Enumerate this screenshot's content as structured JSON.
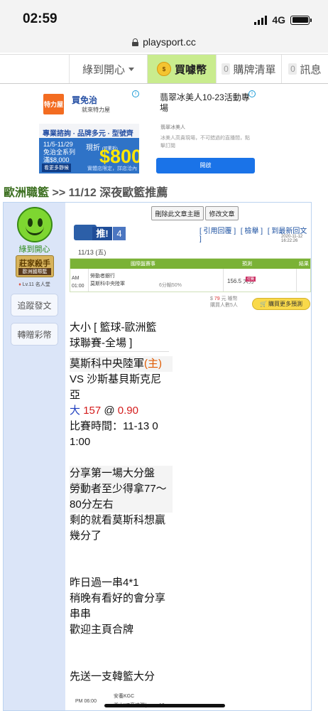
{
  "status": {
    "time": "02:59",
    "network": "4G"
  },
  "browser": {
    "url": "playsport.cc"
  },
  "nav": {
    "login": "綠到開心",
    "buy": "買噱幣",
    "cart_count": "0",
    "cart": "購牌清單",
    "msg_count": "0",
    "msg": "訊息"
  },
  "ads": {
    "left": {
      "brand": "特力屋",
      "headline": "買免治",
      "headline2": "就來特力屋",
      "sub": "專業諮詢 · 品牌多元 · 型號齊全",
      "date": "11/5-11/29",
      "promo": "免治全系列",
      "threshold": "滿$8,000",
      "cash": "現折",
      "cash_note": "(可累折)",
      "amount": "$800",
      "more": "看更多靜候",
      "note": "實體店限定，詳店洽內"
    },
    "right": {
      "title": "翡翠冰美人10-23活動專場",
      "brand": "翡翠冰美人",
      "desc": "冰美人高貴現場，不可錯過的直播間，點擊訂閱",
      "button": "開啟"
    }
  },
  "breadcrumb": {
    "category": "歐洲職籃",
    "sep": ">>",
    "title": "11/12 深夜歐籃推薦"
  },
  "sidebar": {
    "name": "綠到開心",
    "badge_title": "莊家殺手",
    "badge_sub": "歐洲國際籃",
    "level": "Lv.11 名人堂",
    "follow": "追蹤發文",
    "gift": "轉贈彩幣"
  },
  "post": {
    "delete_btn": "刪除此文章主題",
    "edit_btn": "修改文章",
    "push_label": "推!",
    "push_count": "4",
    "link_reply": "[ 引用回覆 ]",
    "link_report": "[ 檢舉 ]",
    "link_latest": "[ 到最新回文 ]",
    "timestamp": "2020-11-12 16:22:26",
    "date": "11/13 (五)",
    "table": {
      "col_game": "國際盤賽事",
      "col_pick": "預測",
      "col_result": "結果",
      "time": "AM 01:00",
      "team1": "勞動者銀行",
      "team2": "莫斯科中央陸軍",
      "pct": "6分輸50%",
      "pick": "156.5 大分",
      "paid": "付費"
    },
    "price_prefix": "$",
    "price": "79",
    "price_suffix": "元 噱幣",
    "buyers": "購買人數5人",
    "buy_button": "購買更多預測"
  },
  "content": {
    "l1": "大小 [ 籃球-歐洲籃",
    "l2": "球聯賽-全場 ]",
    "team_home": "莫斯科中央陸軍",
    "home_tag": "(主)",
    "vs_line1": "VS 沙斯基貝斯克尼",
    "vs_line2": "亞",
    "pick_dir": "大",
    "pick_val": "157",
    "pick_at": "@",
    "pick_odds": "0.90",
    "time_line1": "比賽時間：11-13 0",
    "time_line2": "1:00",
    "p1": "分享第一場大分盤",
    "p2": "勞動者至少得拿77～",
    "p3": "80分左右",
    "p4": "剩的就看莫斯科想贏",
    "p5": "幾分了",
    "p6": "昨日過一串4*1",
    "p7": "稍晚有看好的會分享",
    "p8": "串串",
    "p9": "歡迎主頁合牌",
    "p10": "先送一支韓籃大分"
  },
  "bottom_table": {
    "time": "PM 06:00",
    "team1": "安養KGC",
    "team2": "釜山KT音速彈(",
    "pct": "10"
  }
}
